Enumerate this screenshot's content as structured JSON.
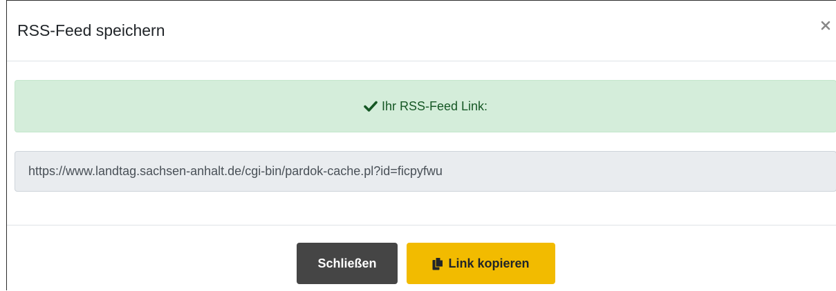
{
  "modal": {
    "title": "RSS-Feed speichern",
    "close_label": "×"
  },
  "alert": {
    "icon": "check-icon",
    "text": "Ihr RSS-Feed Link:",
    "color": "#155724",
    "background": "#d4edda"
  },
  "url_field": {
    "value": "https://www.landtag.sachsen-anhalt.de/cgi-bin/pardok-cache.pl?id=ficpyfwu"
  },
  "footer": {
    "close_button": "Schließen",
    "copy_button": "Link kopieren",
    "copy_icon": "copy-icon",
    "close_button_color": "#454545",
    "copy_button_color": "#f2bb00"
  }
}
